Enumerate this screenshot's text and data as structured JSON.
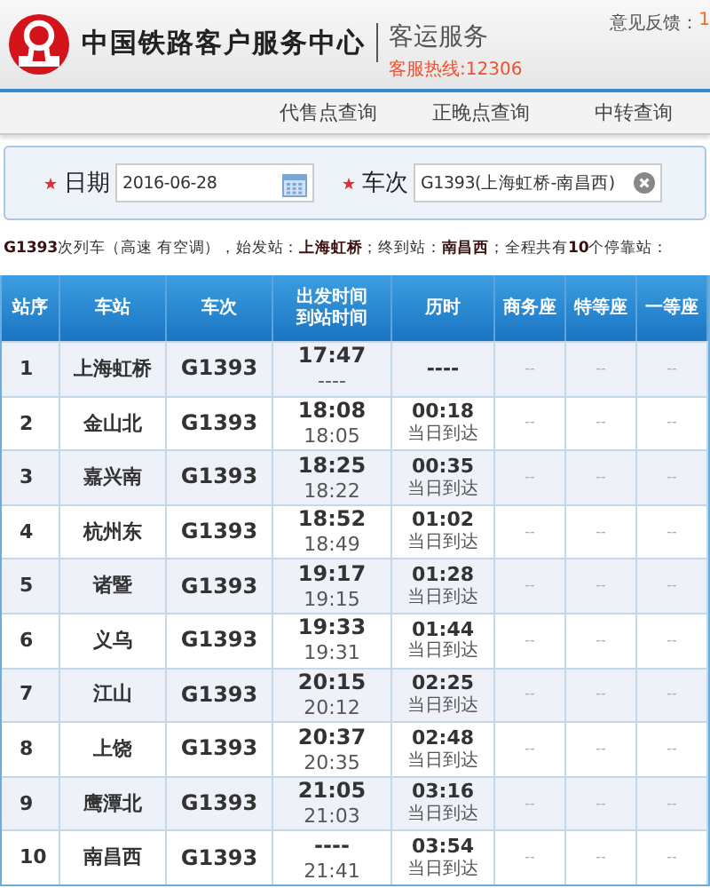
{
  "header": {
    "org_name": "中国铁路客户服务中心",
    "service": "客运服务",
    "hotline": "客服热线:12306",
    "feedback_label": "意见反馈：",
    "feedback_value": "1"
  },
  "nav": [
    {
      "label": "代售点查询"
    },
    {
      "label": "正晚点查询"
    },
    {
      "label": "中转查询"
    }
  ],
  "form": {
    "fields": [
      {
        "label": "日期",
        "required": true,
        "value": "2016-06-28",
        "kind": "date"
      },
      {
        "label": "车次",
        "required": true,
        "value": "G1393(上海虹桥-南昌西)",
        "kind": "text"
      }
    ]
  },
  "summary": "**G1393**次列车（高速 有空调），始发站：**上海虹桥**；终到站：**南昌西**；全程共有**10**个停靠站：",
  "table": {
    "columns": [
      "站序",
      "车站",
      "车次",
      [
        "出发时间",
        "到站时间"
      ],
      "历时",
      "商务座",
      "特等座",
      "一等座"
    ],
    "rows": [
      {
        "seq": "1",
        "station": "上海虹桥",
        "train": "G1393",
        "depart": "17:47",
        "arrive": "----",
        "duration": "----",
        "seats": [
          "--",
          "--",
          "--"
        ]
      },
      {
        "seq": "2",
        "station": "金山北",
        "train": "G1393",
        "depart": "18:08",
        "arrive": "18:05",
        "duration": "00:18",
        "arrival_day": "当日到达",
        "seats": [
          "--",
          "--",
          "--"
        ]
      },
      {
        "seq": "3",
        "station": "嘉兴南",
        "train": "G1393",
        "depart": "18:25",
        "arrive": "18:22",
        "duration": "00:35",
        "arrival_day": "当日到达",
        "seats": [
          "--",
          "--",
          "--"
        ]
      },
      {
        "seq": "4",
        "station": "杭州东",
        "train": "G1393",
        "depart": "18:52",
        "arrive": "18:49",
        "duration": "01:02",
        "arrival_day": "当日到达",
        "seats": [
          "--",
          "--",
          "--"
        ]
      },
      {
        "seq": "5",
        "station": "诸暨",
        "train": "G1393",
        "depart": "19:17",
        "arrive": "19:15",
        "duration": "01:28",
        "arrival_day": "当日到达",
        "seats": [
          "--",
          "--",
          "--"
        ]
      },
      {
        "seq": "6",
        "station": "义乌",
        "train": "G1393",
        "depart": "19:33",
        "arrive": "19:31",
        "duration": "01:44",
        "arrival_day": "当日到达",
        "seats": [
          "--",
          "--",
          "--"
        ]
      },
      {
        "seq": "7",
        "station": "江山",
        "train": "G1393",
        "depart": "20:15",
        "arrive": "20:12",
        "duration": "02:25",
        "arrival_day": "当日到达",
        "seats": [
          "--",
          "--",
          "--"
        ]
      },
      {
        "seq": "8",
        "station": "上饶",
        "train": "G1393",
        "depart": "20:37",
        "arrive": "20:35",
        "duration": "02:48",
        "arrival_day": "当日到达",
        "seats": [
          "--",
          "--",
          "--"
        ]
      },
      {
        "seq": "9",
        "station": "鹰潭北",
        "train": "G1393",
        "depart": "21:05",
        "arrive": "21:03",
        "duration": "03:16",
        "arrival_day": "当日到达",
        "seats": [
          "--",
          "--",
          "--"
        ]
      },
      {
        "seq": "10",
        "station": "南昌西",
        "train": "G1393",
        "depart": "----",
        "arrive": "21:41",
        "duration": "03:54",
        "arrival_day": "当日到达",
        "seats": [
          "--",
          "--",
          "--"
        ]
      }
    ]
  }
}
